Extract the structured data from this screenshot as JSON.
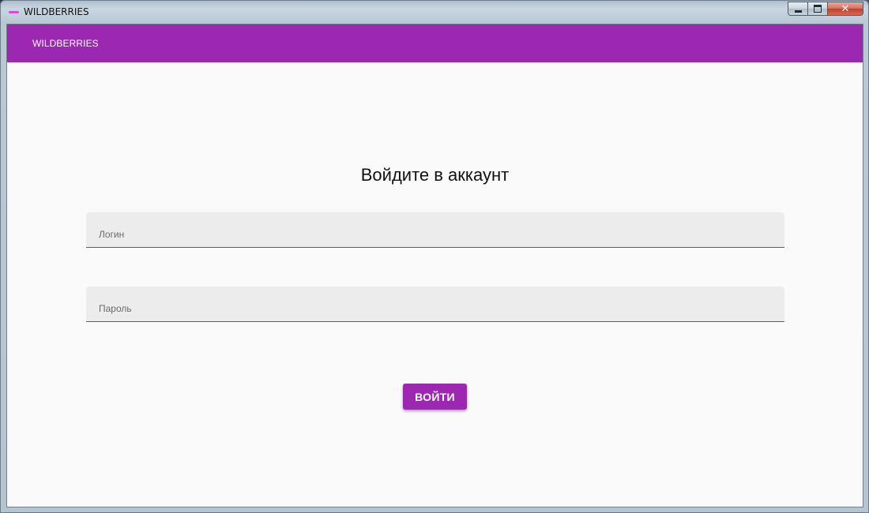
{
  "window": {
    "title": "WILDBERRIES",
    "controls": {
      "minimize_icon": "minimize-icon",
      "maximize_icon": "maximize-icon",
      "close_label": "✕"
    }
  },
  "header": {
    "brand": "WILDBERRIES",
    "background_color": "#9c27b0"
  },
  "login_form": {
    "heading": "Войдите в аккаунт",
    "login_field": {
      "label": "Логин",
      "value": ""
    },
    "password_field": {
      "label": "Пароль",
      "value": ""
    },
    "submit_label": "ВОЙТИ"
  },
  "colors": {
    "accent": "#9c27b0",
    "page_background": "#fafafa",
    "field_background": "#ececec"
  }
}
